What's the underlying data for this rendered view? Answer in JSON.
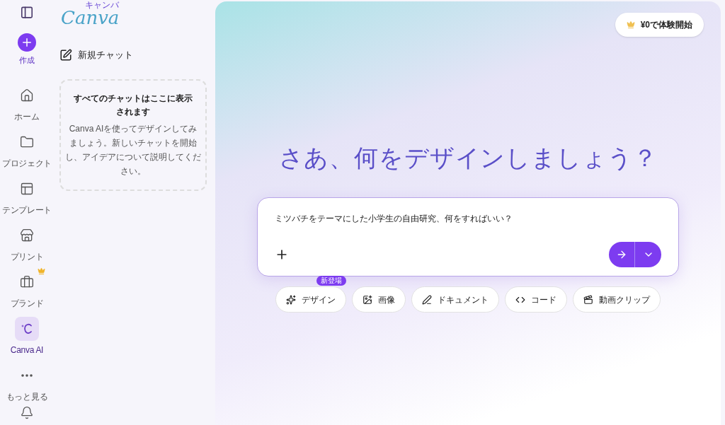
{
  "logo": {
    "name": "Canva",
    "kana": "キャンバ"
  },
  "create": {
    "label": "作成"
  },
  "nav": [
    {
      "label": "ホーム",
      "selected": false
    },
    {
      "label": "プロジェクト",
      "selected": false
    },
    {
      "label": "テンプレート",
      "selected": false
    },
    {
      "label": "プリント",
      "selected": false
    },
    {
      "label": "ブランド",
      "selected": false
    },
    {
      "label": "Canva AI",
      "selected": true
    },
    {
      "label": "もっと見る",
      "selected": false
    }
  ],
  "chat_panel": {
    "new_chat": "新規チャット",
    "empty_title": "すべてのチャットはここに表示されます",
    "empty_body": "Canva AIを使ってデザインしてみましょう。新しいチャットを開始し、アイデアについて説明してください。"
  },
  "trial_button": "¥0で体験開始",
  "heading": "さあ、何をデザインしましょう？",
  "prompt": {
    "value": "ミツバチをテーマにした小学生の自由研究、何をすればいい？"
  },
  "chips": [
    {
      "label": "デザイン",
      "badge": "新登場"
    },
    {
      "label": "画像"
    },
    {
      "label": "ドキュメント"
    },
    {
      "label": "コード"
    },
    {
      "label": "動画クリップ"
    }
  ]
}
